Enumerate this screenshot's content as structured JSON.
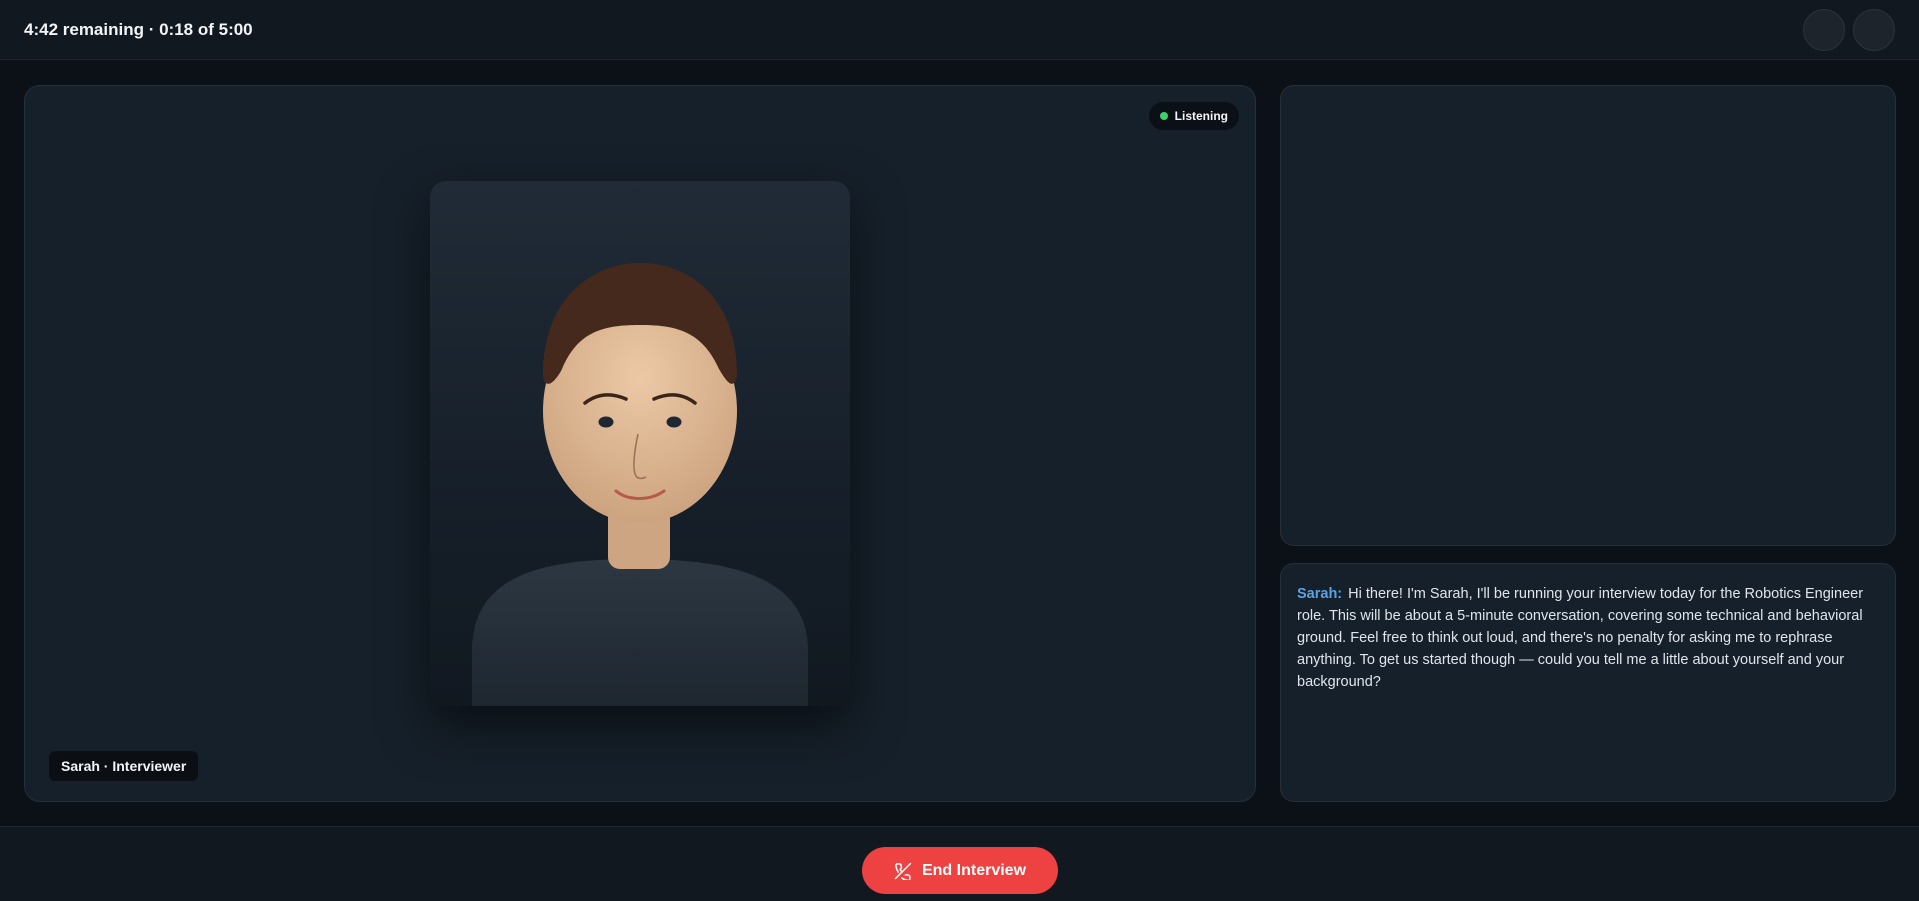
{
  "header": {
    "timer": "4:42 remaining · 0:18 of 5:00",
    "controls": [
      {
        "icon": "circle-button"
      },
      {
        "icon": "circle-button"
      }
    ]
  },
  "video": {
    "status": "Listening",
    "status_color": "#3ecf6f",
    "name_tag": "Sarah · Interviewer"
  },
  "transcript": {
    "speaker": "Sarah:",
    "speaker_color": "#5aa2e6",
    "message": "Hi there! I'm Sarah, I'll be running your interview today for the Robotics Engineer role. This will be about a 5-minute conversation, covering some technical and behavioral ground. Feel free to think out loud, and there's no penalty for asking me to rephrase anything. To get us started though — could you tell me a little about yourself and your background?"
  },
  "footer": {
    "end_button_label": "End Interview",
    "end_button_icon": "phone-off-icon",
    "end_button_color": "#ee4242"
  }
}
